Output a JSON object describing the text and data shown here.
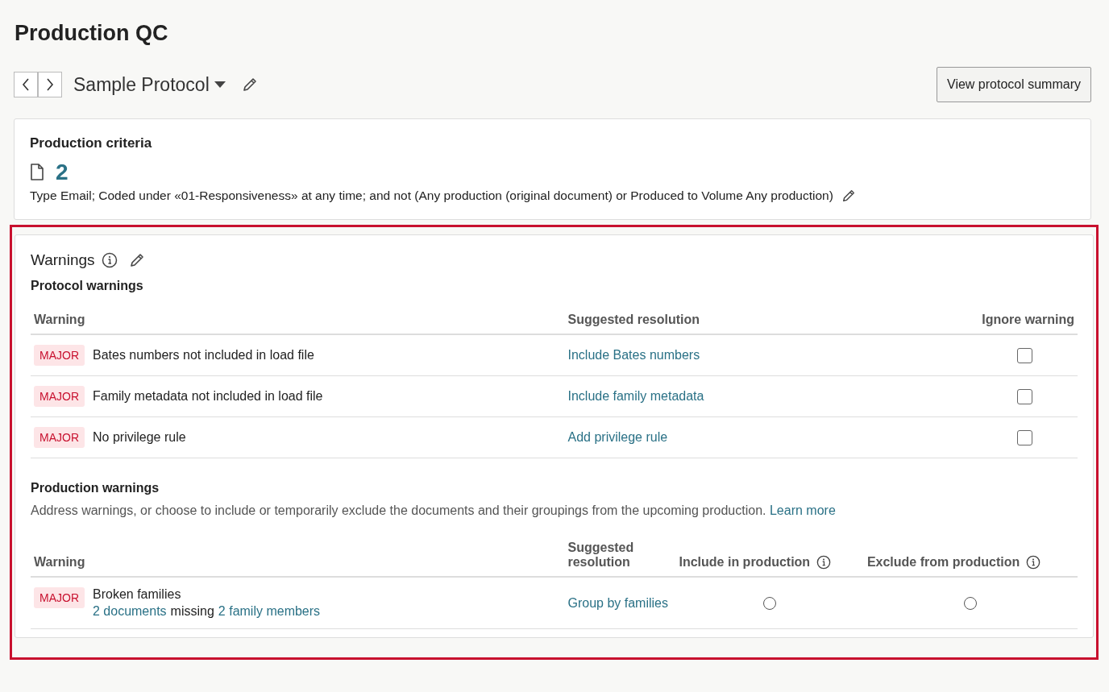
{
  "page_title": "Production QC",
  "protocol": {
    "name": "Sample Protocol",
    "summary_button": "View protocol summary"
  },
  "criteria": {
    "title": "Production criteria",
    "count": "2",
    "description": "Type Email; Coded under «01-Responsiveness» at any time; and not (Any production (original document) or Produced to Volume Any production)"
  },
  "warnings": {
    "title": "Warnings",
    "protocol_section": {
      "title": "Protocol warnings",
      "columns": [
        "Warning",
        "Suggested resolution",
        "Ignore warning"
      ],
      "rows": [
        {
          "severity": "MAJOR",
          "warning": "Bates numbers not included in load file",
          "resolution": "Include Bates numbers",
          "checked": false
        },
        {
          "severity": "MAJOR",
          "warning": "Family metadata not included in load file",
          "resolution": "Include family metadata",
          "checked": false
        },
        {
          "severity": "MAJOR",
          "warning": "No privilege rule",
          "resolution": "Add privilege rule",
          "checked": false
        }
      ]
    },
    "production_section": {
      "title": "Production warnings",
      "description": "Address warnings, or choose to include or temporarily exclude the documents and their groupings from the upcoming production.",
      "learn_more": "Learn more",
      "columns": [
        "Warning",
        "Suggested resolution",
        "Include in production",
        "Exclude from production"
      ],
      "rows": [
        {
          "severity": "MAJOR",
          "warning": "Broken families",
          "detail": [
            {
              "text": "2 documents",
              "link": true
            },
            {
              "text": "missing",
              "link": false
            },
            {
              "text": "2 family members",
              "link": true
            }
          ],
          "resolution": "Group by families",
          "include": {
            "selected": false
          },
          "exclude": {
            "selected": false
          }
        }
      ]
    }
  }
}
